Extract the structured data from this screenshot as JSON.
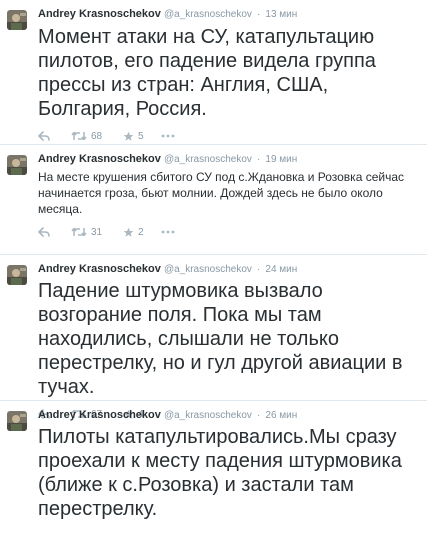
{
  "colors": {
    "text": "#292f33",
    "meta": "#8899a6",
    "action_icon": "#aab8c2",
    "divider": "#e1e8ed"
  },
  "tweets": [
    {
      "name": "Andrey Krasnoschekov",
      "handle": "@a_krasnoschekov",
      "time": "13 мин",
      "text": "Момент атаки на СУ, катапультацию пилотов, его падение видела группа прессы из стран: Англия, США, Болгария, Россия.",
      "retweets": "68",
      "favorites": "5"
    },
    {
      "name": "Andrey Krasnoschekov",
      "handle": "@a_krasnoschekov",
      "time": "19 мин",
      "text": "На месте крушения сбитого СУ под с.Ждановка и Розовка сейчас начинается гроза, бьют молнии. Дождей здесь не было около месяца.",
      "retweets": "31",
      "favorites": "2"
    },
    {
      "name": "Andrey Krasnoschekov",
      "handle": "@a_krasnoschekov",
      "time": "24 мин",
      "text": "Падение штурмовика вызвало возгорание поля. Пока мы там находились, слышали не только перестрелку, но и гул другой авиации в тучах.",
      "retweets": "67",
      "favorites": "4"
    },
    {
      "name": "Andrey Krasnoschekov",
      "handle": "@a_krasnoschekov",
      "time": "26 мин",
      "text": "Пилоты катапультировались.Мы сразу проехали к месту падения штурмовика (ближе к с.Розовка) и застали там перестрелку."
    }
  ],
  "icons": {
    "avatar": "avatar-photo",
    "reply": "reply-arrow",
    "retweet": "retweet-arrows",
    "favorite": "star",
    "more": "ellipsis"
  }
}
